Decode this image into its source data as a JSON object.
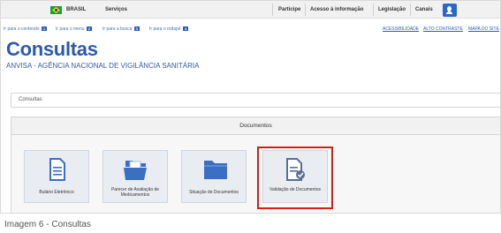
{
  "govbar": {
    "country": "BRASIL",
    "services": "Serviços",
    "links": [
      "Participe",
      "Acesso à informação",
      "Legislação",
      "Canais"
    ]
  },
  "skip_links": [
    {
      "label": "Ir para o conteúdo",
      "key": "1"
    },
    {
      "label": "Ir para o menu",
      "key": "2"
    },
    {
      "label": "Ir para a busca",
      "key": "3"
    },
    {
      "label": "Ir para o rodapé",
      "key": "4"
    }
  ],
  "accessibility_links": [
    "ACESSIBILIDADE",
    "ALTO CONTRASTE",
    "MAPA DO SITE"
  ],
  "page": {
    "title": "Consultas",
    "subtitle": "ANVISA - AGÊNCIA NACIONAL DE VIGILÂNCIA SANITÁRIA"
  },
  "breadcrumb": "Consultas",
  "panel": {
    "heading": "Documentos",
    "cards": [
      {
        "label": "Bulário Eletrônico",
        "icon": "document-icon"
      },
      {
        "label": "Parecer de Avaliação de Medicamentos",
        "icon": "open-folder-icon"
      },
      {
        "label": "Situação de Documentos",
        "icon": "folder-icon"
      },
      {
        "label": "Validação de Documentos",
        "icon": "document-check-icon"
      }
    ]
  },
  "caption": "Imagem 6 - Consultas",
  "colors": {
    "accent": "#2d5aa8",
    "highlight": "#d81b1b",
    "icon_blue": "#3a6fc4"
  }
}
